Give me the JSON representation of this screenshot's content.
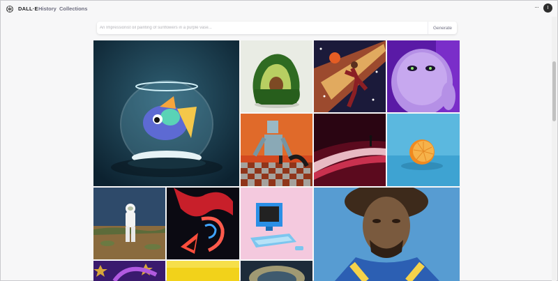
{
  "header": {
    "brand": "DALL·E",
    "nav": [
      {
        "label": "History"
      },
      {
        "label": "Collections"
      }
    ],
    "more_label": "···",
    "avatar_initial": "I"
  },
  "prompt": {
    "placeholder": "An Impressionist oil painting of sunflowers in a purple vase...",
    "value": "",
    "button_label": "Generate"
  },
  "gallery": [
    {
      "icon": "fishbowl-image"
    },
    {
      "icon": "avocado-armchair-image"
    },
    {
      "icon": "cosmic-basketball-player-image"
    },
    {
      "icon": "purple-monster-image"
    },
    {
      "icon": "robot-chess-painting-image"
    },
    {
      "icon": "red-light-landscape-image"
    },
    {
      "icon": "orange-half-image"
    },
    {
      "icon": "astronaut-desert-image"
    },
    {
      "icon": "neon-abstract-image"
    },
    {
      "icon": "retro-computer-image"
    },
    {
      "icon": "portrait-painting-image"
    },
    {
      "icon": "purple-stars-image"
    },
    {
      "icon": "yellow-image"
    },
    {
      "icon": "planet-storm-image"
    }
  ],
  "colors": {
    "background": "#f7f7f8",
    "text": "#202123",
    "muted": "#6e6e80"
  }
}
